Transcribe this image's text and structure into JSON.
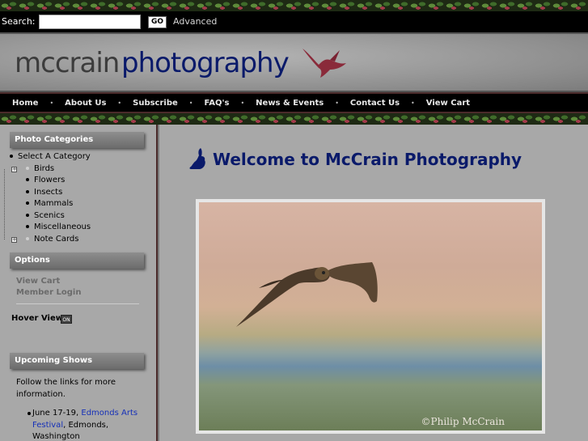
{
  "search": {
    "label": "Search:",
    "value": "",
    "placeholder": "",
    "go_label": "GO",
    "advanced_label": "Advanced"
  },
  "logo": {
    "part1": "mccrain",
    "part2": "photography"
  },
  "nav": [
    "Home",
    "About Us",
    "Subscribe",
    "FAQ's",
    "News & Events",
    "Contact Us",
    "View Cart"
  ],
  "nav_separator": "•",
  "sidebar": {
    "categories_header": "Photo Categories",
    "categories": [
      {
        "label": "Select A Category",
        "expandable": false
      },
      {
        "label": "Birds",
        "expandable": true
      },
      {
        "label": "Flowers",
        "expandable": false
      },
      {
        "label": "Insects",
        "expandable": false
      },
      {
        "label": "Mammals",
        "expandable": false
      },
      {
        "label": "Scenics",
        "expandable": false
      },
      {
        "label": "Miscellaneous",
        "expandable": false
      },
      {
        "label": "Note Cards",
        "expandable": true
      }
    ],
    "options_header": "Options",
    "options": [
      "View Cart",
      "Member Login"
    ],
    "hover_view_label": "Hover View:",
    "hover_toggle": "ON",
    "shows_header": "Upcoming Shows",
    "shows_intro": "Follow the links for more information.",
    "shows": [
      {
        "date": "June 17-19,",
        "link": "Edmonds Arts Festival",
        "location": ", Edmonds, Washington"
      }
    ]
  },
  "main": {
    "title": "Welcome to McCrain Photography",
    "photo_credit": "©Philip McCrain"
  },
  "colors": {
    "title": "#0a1a6a",
    "link": "#1530b8",
    "background": "#a8a8a8"
  }
}
